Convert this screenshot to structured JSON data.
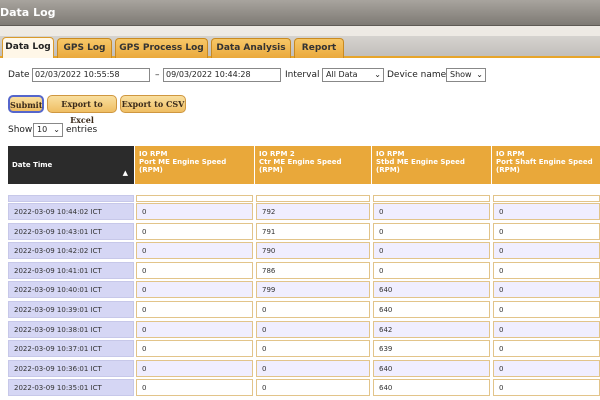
{
  "window": {
    "title": "Data Log"
  },
  "tabs": [
    {
      "label": "Data Log",
      "active": true
    },
    {
      "label": "GPS Log",
      "active": false
    },
    {
      "label": "GPS Process Log",
      "active": false
    },
    {
      "label": "Data Analysis",
      "active": false
    },
    {
      "label": "Report",
      "active": false
    }
  ],
  "filter": {
    "date_label": "Date",
    "date_from": "02/03/2022 10:55:58",
    "date_sep": "–",
    "date_to": "09/03/2022 10:44:28",
    "interval_label": "Interval",
    "interval_value": "All Data",
    "device_label": "Device name",
    "device_value": "Show"
  },
  "buttons": {
    "submit": "Submit",
    "export_excel": "Export to Excel",
    "export_csv": "Export to CSV"
  },
  "entries": {
    "show_label": "Show",
    "count": "10",
    "suffix": "entries"
  },
  "table": {
    "headers": [
      {
        "title": "Date Time"
      },
      {
        "title": "IO RPM",
        "sub": "Port ME Engine Speed",
        "unit": "(RPM)"
      },
      {
        "title": "IO RPM 2",
        "sub": "Ctr ME Engine Speed",
        "unit": "(RPM)"
      },
      {
        "title": "IO RPM",
        "sub": "Stbd ME Engine Speed",
        "unit": "(RPM)"
      },
      {
        "title": "IO RPM",
        "sub": "Port Shaft Engine Speed",
        "unit": "(RPM)"
      }
    ],
    "rows": [
      [
        "2022-03-09 10:44:02 ICT",
        "0",
        "792",
        "0",
        "0"
      ],
      [
        "2022-03-09 10:43:01 ICT",
        "0",
        "791",
        "0",
        "0"
      ],
      [
        "2022-03-09 10:42:02 ICT",
        "0",
        "790",
        "0",
        "0"
      ],
      [
        "2022-03-09 10:41:01 ICT",
        "0",
        "786",
        "0",
        "0"
      ],
      [
        "2022-03-09 10:40:01 ICT",
        "0",
        "799",
        "640",
        "0"
      ],
      [
        "2022-03-09 10:39:01 ICT",
        "0",
        "0",
        "640",
        "0"
      ],
      [
        "2022-03-09 10:38:01 ICT",
        "0",
        "0",
        "642",
        "0"
      ],
      [
        "2022-03-09 10:37:01 ICT",
        "0",
        "0",
        "639",
        "0"
      ],
      [
        "2022-03-09 10:36:01 ICT",
        "0",
        "0",
        "640",
        "0"
      ],
      [
        "2022-03-09 10:35:01 ICT",
        "0",
        "0",
        "640",
        "0"
      ]
    ]
  }
}
